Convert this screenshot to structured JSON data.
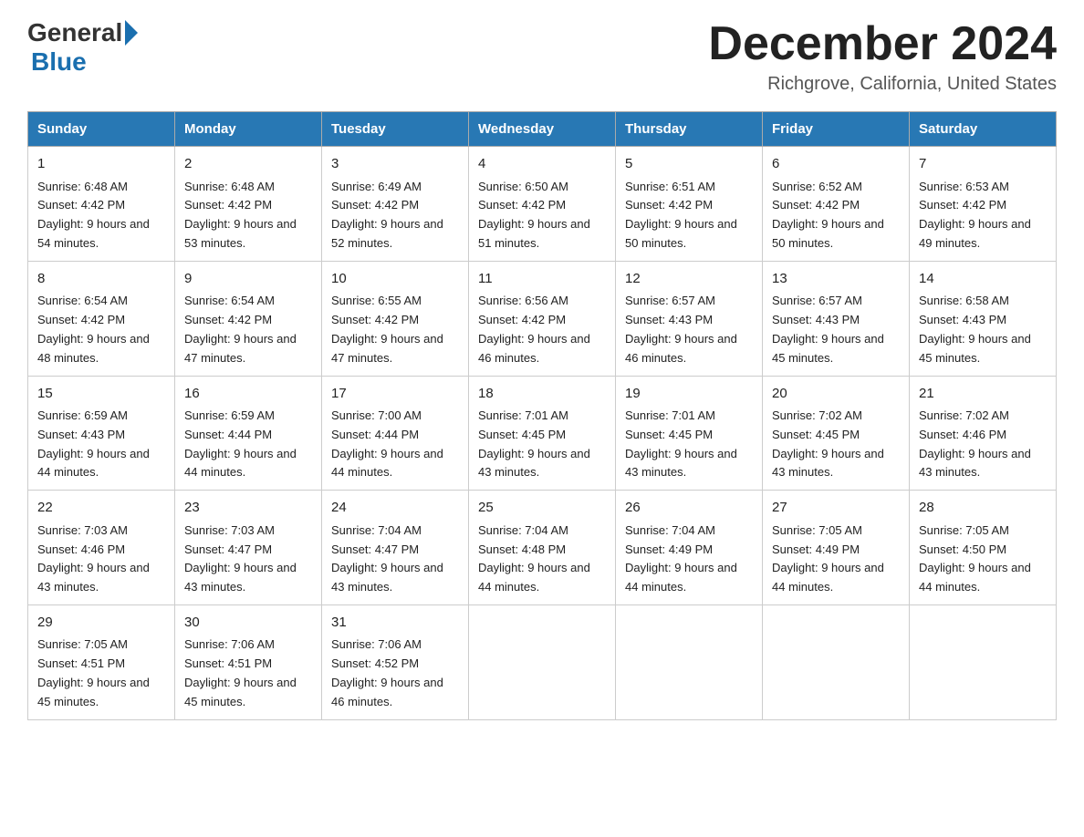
{
  "header": {
    "logo_general": "General",
    "logo_blue": "Blue",
    "month_title": "December 2024",
    "location": "Richgrove, California, United States"
  },
  "weekdays": [
    "Sunday",
    "Monday",
    "Tuesday",
    "Wednesday",
    "Thursday",
    "Friday",
    "Saturday"
  ],
  "weeks": [
    [
      {
        "day": "1",
        "sunrise": "6:48 AM",
        "sunset": "4:42 PM",
        "daylight": "9 hours and 54 minutes."
      },
      {
        "day": "2",
        "sunrise": "6:48 AM",
        "sunset": "4:42 PM",
        "daylight": "9 hours and 53 minutes."
      },
      {
        "day": "3",
        "sunrise": "6:49 AM",
        "sunset": "4:42 PM",
        "daylight": "9 hours and 52 minutes."
      },
      {
        "day": "4",
        "sunrise": "6:50 AM",
        "sunset": "4:42 PM",
        "daylight": "9 hours and 51 minutes."
      },
      {
        "day": "5",
        "sunrise": "6:51 AM",
        "sunset": "4:42 PM",
        "daylight": "9 hours and 50 minutes."
      },
      {
        "day": "6",
        "sunrise": "6:52 AM",
        "sunset": "4:42 PM",
        "daylight": "9 hours and 50 minutes."
      },
      {
        "day": "7",
        "sunrise": "6:53 AM",
        "sunset": "4:42 PM",
        "daylight": "9 hours and 49 minutes."
      }
    ],
    [
      {
        "day": "8",
        "sunrise": "6:54 AM",
        "sunset": "4:42 PM",
        "daylight": "9 hours and 48 minutes."
      },
      {
        "day": "9",
        "sunrise": "6:54 AM",
        "sunset": "4:42 PM",
        "daylight": "9 hours and 47 minutes."
      },
      {
        "day": "10",
        "sunrise": "6:55 AM",
        "sunset": "4:42 PM",
        "daylight": "9 hours and 47 minutes."
      },
      {
        "day": "11",
        "sunrise": "6:56 AM",
        "sunset": "4:42 PM",
        "daylight": "9 hours and 46 minutes."
      },
      {
        "day": "12",
        "sunrise": "6:57 AM",
        "sunset": "4:43 PM",
        "daylight": "9 hours and 46 minutes."
      },
      {
        "day": "13",
        "sunrise": "6:57 AM",
        "sunset": "4:43 PM",
        "daylight": "9 hours and 45 minutes."
      },
      {
        "day": "14",
        "sunrise": "6:58 AM",
        "sunset": "4:43 PM",
        "daylight": "9 hours and 45 minutes."
      }
    ],
    [
      {
        "day": "15",
        "sunrise": "6:59 AM",
        "sunset": "4:43 PM",
        "daylight": "9 hours and 44 minutes."
      },
      {
        "day": "16",
        "sunrise": "6:59 AM",
        "sunset": "4:44 PM",
        "daylight": "9 hours and 44 minutes."
      },
      {
        "day": "17",
        "sunrise": "7:00 AM",
        "sunset": "4:44 PM",
        "daylight": "9 hours and 44 minutes."
      },
      {
        "day": "18",
        "sunrise": "7:01 AM",
        "sunset": "4:45 PM",
        "daylight": "9 hours and 43 minutes."
      },
      {
        "day": "19",
        "sunrise": "7:01 AM",
        "sunset": "4:45 PM",
        "daylight": "9 hours and 43 minutes."
      },
      {
        "day": "20",
        "sunrise": "7:02 AM",
        "sunset": "4:45 PM",
        "daylight": "9 hours and 43 minutes."
      },
      {
        "day": "21",
        "sunrise": "7:02 AM",
        "sunset": "4:46 PM",
        "daylight": "9 hours and 43 minutes."
      }
    ],
    [
      {
        "day": "22",
        "sunrise": "7:03 AM",
        "sunset": "4:46 PM",
        "daylight": "9 hours and 43 minutes."
      },
      {
        "day": "23",
        "sunrise": "7:03 AM",
        "sunset": "4:47 PM",
        "daylight": "9 hours and 43 minutes."
      },
      {
        "day": "24",
        "sunrise": "7:04 AM",
        "sunset": "4:47 PM",
        "daylight": "9 hours and 43 minutes."
      },
      {
        "day": "25",
        "sunrise": "7:04 AM",
        "sunset": "4:48 PM",
        "daylight": "9 hours and 44 minutes."
      },
      {
        "day": "26",
        "sunrise": "7:04 AM",
        "sunset": "4:49 PM",
        "daylight": "9 hours and 44 minutes."
      },
      {
        "day": "27",
        "sunrise": "7:05 AM",
        "sunset": "4:49 PM",
        "daylight": "9 hours and 44 minutes."
      },
      {
        "day": "28",
        "sunrise": "7:05 AM",
        "sunset": "4:50 PM",
        "daylight": "9 hours and 44 minutes."
      }
    ],
    [
      {
        "day": "29",
        "sunrise": "7:05 AM",
        "sunset": "4:51 PM",
        "daylight": "9 hours and 45 minutes."
      },
      {
        "day": "30",
        "sunrise": "7:06 AM",
        "sunset": "4:51 PM",
        "daylight": "9 hours and 45 minutes."
      },
      {
        "day": "31",
        "sunrise": "7:06 AM",
        "sunset": "4:52 PM",
        "daylight": "9 hours and 46 minutes."
      },
      null,
      null,
      null,
      null
    ]
  ],
  "labels": {
    "sunrise_prefix": "Sunrise: ",
    "sunset_prefix": "Sunset: ",
    "daylight_prefix": "Daylight: "
  }
}
